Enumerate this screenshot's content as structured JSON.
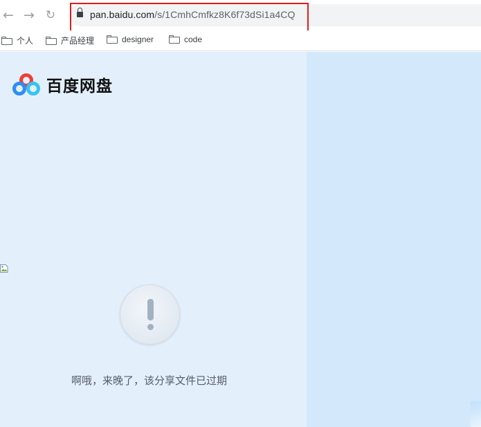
{
  "browser": {
    "url_host": "pan.baidu.com",
    "url_path": "/s/1CmhCmfkz8K6f73dSi1a4CQ",
    "bookmarks": [
      {
        "label": "个人"
      },
      {
        "label": "产品经理"
      },
      {
        "label": "designer"
      },
      {
        "label": "code"
      }
    ]
  },
  "header": {
    "logo_text": "百度网盘"
  },
  "main": {
    "message": "啊哦，来晚了，该分享文件已过期"
  },
  "colors": {
    "accent_highlight": "#e01b1b",
    "logo_red": "#ef3e36",
    "logo_blue": "#2f8cf4",
    "logo_cyan": "#36c3f2",
    "panel_left": "#e3f0fc",
    "panel_right": "#d3e8fb"
  }
}
